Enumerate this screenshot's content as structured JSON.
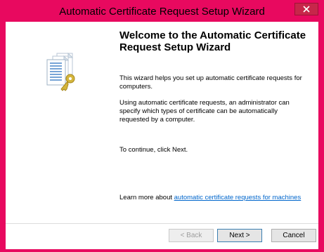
{
  "window": {
    "title": "Automatic Certificate Request Setup Wizard",
    "close_icon": "close-icon",
    "close_color": "#c7264a",
    "frame_color": "#e8095f"
  },
  "art": {
    "icon": "certificate-documents-with-key-icon"
  },
  "content": {
    "heading": "Welcome to the Automatic Certificate Request Setup Wizard",
    "intro": "This wizard helps you set up automatic certificate requests for computers.",
    "details": "Using automatic certificate requests, an administrator can specify which types of certificate can be automatically requested by a computer.",
    "continue_text": "To continue, click Next.",
    "learn_more_prefix": "Learn more about",
    "learn_more_link": "automatic certificate requests for machines",
    "link_color": "#0066cc"
  },
  "buttons": {
    "back": "< Back",
    "next": "Next >",
    "cancel": "Cancel"
  }
}
